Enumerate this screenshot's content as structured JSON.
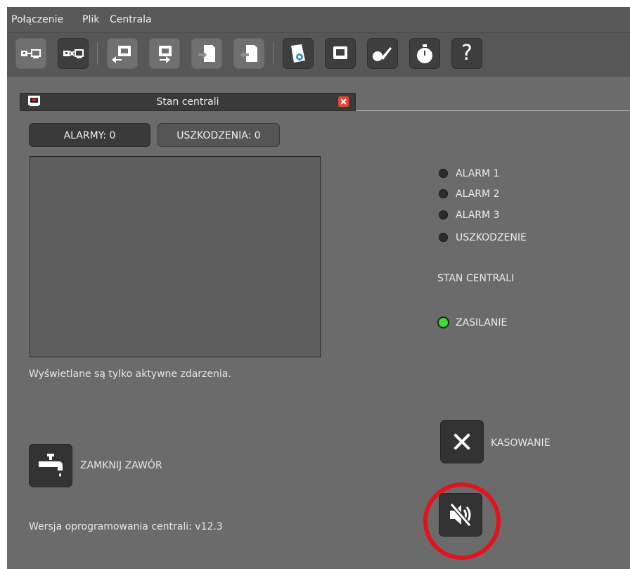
{
  "menubar": {
    "items": [
      {
        "label": "Połączenie"
      },
      {
        "label": "Plik"
      },
      {
        "label": "Centrala"
      }
    ]
  },
  "toolbar": {
    "buttons": [
      {
        "icon": "connect-icon"
      },
      {
        "icon": "disconnect-icon"
      },
      {
        "icon": "read-from-panel-icon"
      },
      {
        "icon": "write-to-panel-icon"
      },
      {
        "icon": "import-file-icon"
      },
      {
        "icon": "export-file-icon"
      },
      {
        "icon": "config-document-icon"
      },
      {
        "icon": "panel-state-icon"
      },
      {
        "icon": "test-icon"
      },
      {
        "icon": "timer-icon"
      },
      {
        "icon": "help-icon",
        "label": "?"
      }
    ]
  },
  "tab": {
    "title": "Stan centrali",
    "close_color": "#e0453a"
  },
  "counters": {
    "alarms_label": "ALARMY: 0",
    "faults_label": "USZKODZENIA: 0"
  },
  "events": {
    "note": "Wyświetlane są tylko aktywne zdarzenia."
  },
  "indicators": [
    {
      "label": "ALARM 1",
      "active": false
    },
    {
      "label": "ALARM 2",
      "active": false
    },
    {
      "label": "ALARM 3",
      "active": false
    },
    {
      "label": "USZKODZENIE",
      "active": false
    }
  ],
  "panel_state": {
    "title": "STAN CENTRALI",
    "power_label": "ZASILANIE",
    "power_active": true,
    "power_color": "#3ddc32"
  },
  "actions": {
    "reset_label": "KASOWANIE",
    "close_valve_label": "ZAMKNIJ ZAWÓR",
    "mute_icon": "speaker-mute-icon"
  },
  "firmware": {
    "label": "Wersja oprogramowania centrali: v12.3"
  },
  "colors": {
    "background": "#6b6b6b",
    "highlight_ring": "#e3131c"
  }
}
